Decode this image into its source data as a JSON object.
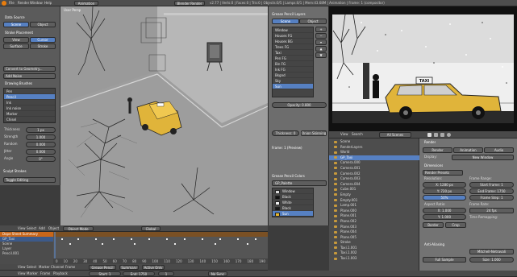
{
  "topbar": {
    "menus": [
      "File",
      "Render",
      "Window",
      "Help"
    ],
    "layout": "Animation",
    "engine": "Blender Render",
    "status": "v2.77 | Verts:0 | Faces:0 | Tris:0 | Objects:0/5 | Lamps:0/1 | Mem:43.68M | Animation | Frame: 1 (compositor)"
  },
  "left_panel": {
    "sections": [
      "Data Source",
      "Stroke Placement",
      "Drawing Brushes"
    ],
    "source_options": [
      "Scene",
      "Object"
    ],
    "placement_options": [
      "View",
      "Cursor",
      "Surface",
      "Stroke"
    ],
    "convert_label": "Convert to Geometry...",
    "add_noise": "Add Noise",
    "brushes": [
      "Pen",
      "Pencil",
      "Ink",
      "Ink noise",
      "Marker",
      "Chisel"
    ],
    "selected_brush": "Pencil",
    "props": [
      "Thickness",
      "Strength",
      "Random",
      "Jitter",
      "Angle"
    ],
    "prop_values": [
      "1 px",
      "1.000",
      "0.000",
      "0.000",
      "0°"
    ],
    "sculpt_label": "Sculpt Strokes",
    "toggle_label": "Toggle Editing"
  },
  "viewport": {
    "header_items": [
      "View",
      "Select",
      "Add",
      "Object",
      "Object Mode",
      "Global"
    ],
    "corner_label": "User Persp"
  },
  "gp_panel": {
    "title": "Grease Pencil Layers",
    "tabs": [
      "Scene",
      "Object"
    ],
    "layers": [
      "Window",
      "Houses FG",
      "Houses BG",
      "Trees FG",
      "Taxi",
      "Pen FG",
      "Bin FG",
      "Ink FG",
      "Bkgnd",
      "Sky",
      "Sun"
    ],
    "selected_layer": "Sun",
    "opacity_label": "Opacity:",
    "opacity_value": "0.800",
    "thickness_label": "Thickness:",
    "thickness_value": "0",
    "onion_label": "Onion Skinning",
    "frame_label": "Frame: 1 (Preview)",
    "colors_title": "Grease Pencil Colors",
    "palette_name": "GP_Palette",
    "colors": [
      {
        "name": "Window",
        "hex": "#d8d8d8"
      },
      {
        "name": "Black",
        "hex": "#111111"
      },
      {
        "name": "White",
        "hex": "#f2f2f2"
      },
      {
        "name": "Black",
        "hex": "#1a1a1a"
      },
      {
        "name": "Sun",
        "hex": "#e8b82c"
      }
    ],
    "selected_color": "Sun"
  },
  "render_preview": {
    "taxi_sign": "TAXI"
  },
  "outliner": {
    "header": [
      "View",
      "Search",
      "All Scenes"
    ],
    "items": [
      "Scene",
      "RenderLayers",
      "World",
      "GP_Taxi",
      "Camera.000",
      "Camera.001",
      "Camera.002",
      "Camera.003",
      "Camera.004",
      "Cube.001",
      "Empty",
      "Empty.001",
      "Lamp.001",
      "Plane.000",
      "Plane.001",
      "Plane.002",
      "Plane.003",
      "Plane.004",
      "Plane.005",
      "Stroke",
      "Taxi.1.001",
      "Taxi.1.002",
      "Taxi.1.003"
    ],
    "selected": "GP_Taxi"
  },
  "properties": {
    "sections": [
      "Render",
      "Dimensions",
      "Anti-Aliasing"
    ],
    "render_buttons": [
      "Render",
      "Animation",
      "Audio"
    ],
    "display_label": "Display:",
    "display_value": "New Window",
    "presets": "Render Presets",
    "resolution_label": "Resolution:",
    "res_x": "X: 1280 px",
    "res_y": "Y: 720 px",
    "res_pct": "50%",
    "frame_range_label": "Frame Range:",
    "start_frame": "Start Frame: 1",
    "end_frame": "End Frame: 1750",
    "frame_step": "Frame Step: 1",
    "aspect_label": "Aspect Ratio:",
    "aspect_x": "X: 1.000",
    "aspect_y": "Y: 1.000",
    "frame_rate_label": "Frame Rate:",
    "frame_rate": "24 fps",
    "time_remap": "Time Remapping:",
    "border": "Border",
    "crop": "Crop",
    "filter": "Mitchell-Netravali",
    "full_sample": "Full Sample",
    "size": "Size: 1.000"
  },
  "timeline": {
    "tracks": [
      "Dope Sheet Summary",
      "GP_Taxi",
      "Scene",
      "Layer",
      "Pencil.001"
    ],
    "frame_numbers": [
      "0",
      "10",
      "20",
      "30",
      "40",
      "50",
      "60",
      "70",
      "80",
      "90",
      "100",
      "110",
      "120",
      "130",
      "140",
      "150",
      "160",
      "170",
      "180",
      "190"
    ],
    "header_items": [
      "View",
      "Select",
      "Marker",
      "Channel",
      "Frame",
      "Grease Pencil",
      "Summary",
      "Active Only"
    ],
    "bottom_items": [
      "View",
      "Marker",
      "Frame",
      "Playback"
    ],
    "start": "Start: 1",
    "end": "End: 1750",
    "current": "1",
    "no_sync": "No Sync"
  }
}
